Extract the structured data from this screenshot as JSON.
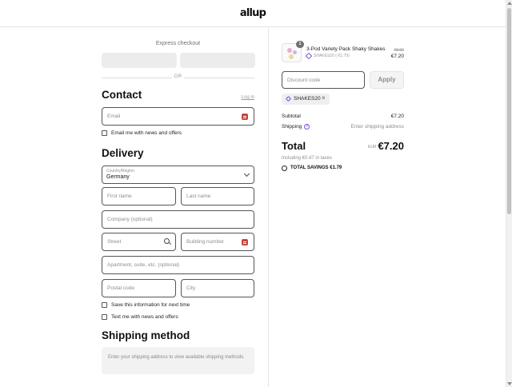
{
  "brand": {
    "logo": "allup"
  },
  "express": {
    "title": "Express checkout",
    "or": "OR"
  },
  "contact": {
    "title": "Contact",
    "login": "Log in",
    "email_placeholder": "Email",
    "newsletter": "Email me with news and offers"
  },
  "delivery": {
    "title": "Delivery",
    "country_label": "Country/Region",
    "country_value": "Germany",
    "first_name": "First name",
    "last_name": "Last name",
    "company": "Company (optional)",
    "street": "Street",
    "building": "Building number",
    "apartment": "Apartment, suite, etc. (optional)",
    "postal": "Postal code",
    "city": "City",
    "save_info": "Save this information for next time",
    "text_me": "Text me with news and offers"
  },
  "shipping_method": {
    "title": "Shipping method",
    "notice": "Enter your shipping address to view available shipping methods."
  },
  "summary": {
    "product": {
      "quantity": "1",
      "name": "3-Pod Variety Pack Shaky Shakes",
      "discount": "SHAKES20 (-€1.79)",
      "original_price": "€8.99",
      "price": "€7.20"
    },
    "discount_placeholder": "Discount code",
    "apply": "Apply",
    "applied_code": "SHAKES20",
    "subtotal_label": "Subtotal",
    "subtotal_value": "€7.20",
    "shipping_label": "Shipping",
    "shipping_value": "Enter shipping address",
    "total_label": "Total",
    "currency": "EUR",
    "total_value": "€7.20",
    "taxes": "Including €0.47 in taxes",
    "savings": "TOTAL SAVINGS  €1.79"
  },
  "colors": {
    "accent": "#7c4fd9",
    "badge": "#c7453a"
  }
}
